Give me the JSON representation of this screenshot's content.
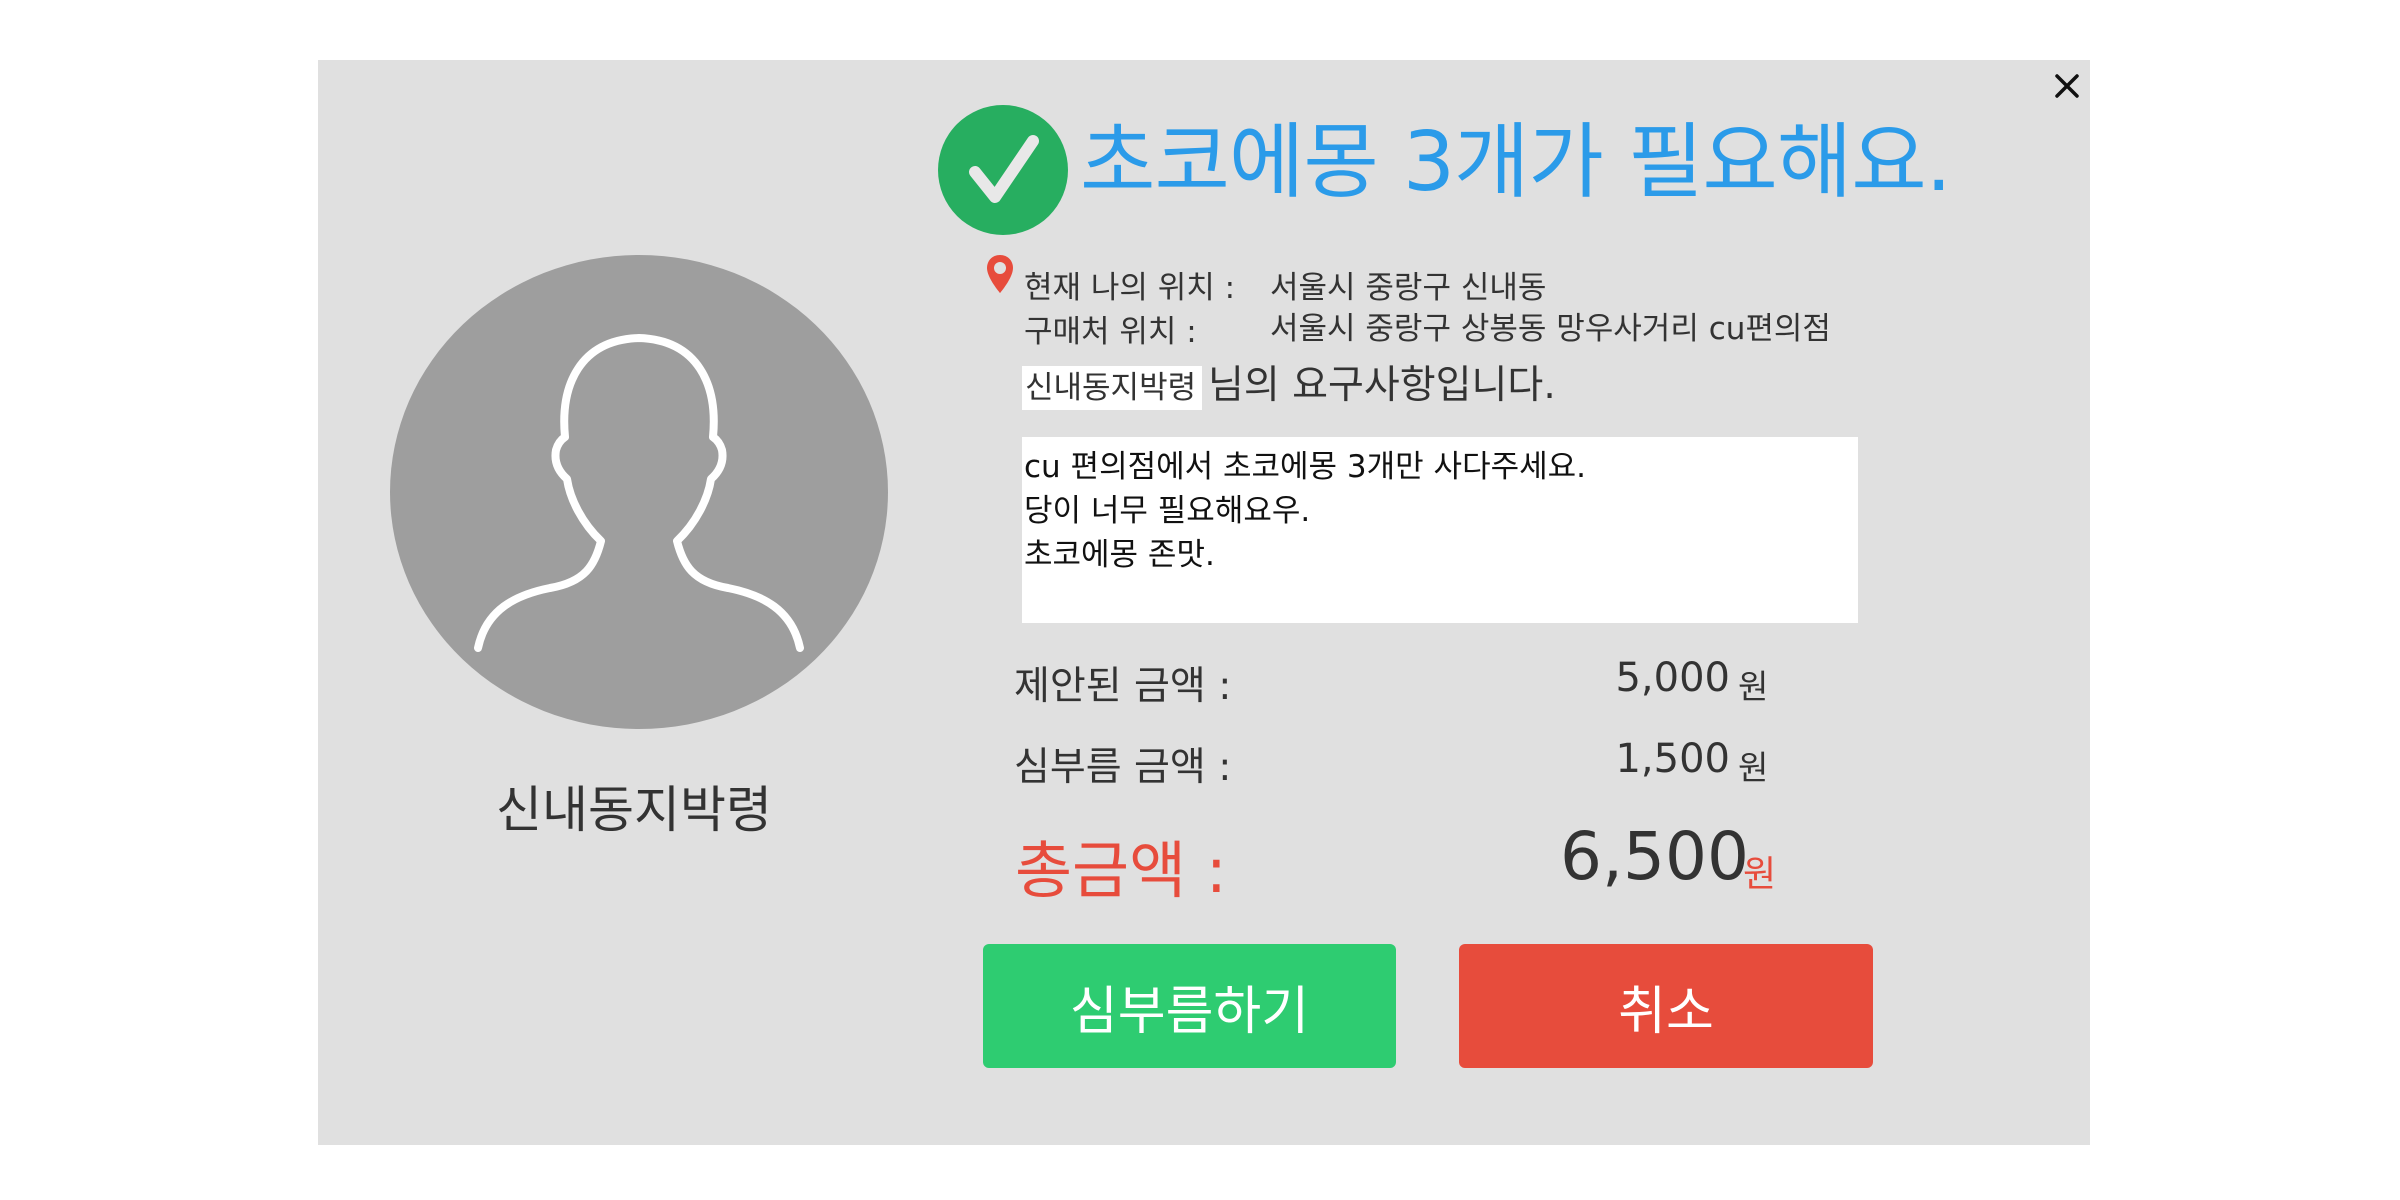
{
  "dialog": {
    "title": "초코에몽 3개가 필요해요.",
    "close_icon": "close-icon"
  },
  "user": {
    "name": "신내동지박령",
    "avatar_icon": "user-silhouette-icon"
  },
  "location": {
    "current_label": "현재 나의 위치 :",
    "current_value": "서울시 중랑구 신내동",
    "store_label": "구매처 위치 :",
    "store_value": "서울시 중랑구 상봉동 망우사거리 cu편의점",
    "pin_icon": "location-pin-icon"
  },
  "request": {
    "user_name": "신내동지박령",
    "suffix": "님의 요구사항입니다.",
    "lines": [
      "cu 편의점에서 초코에몽 3개만 사다주세요.",
      "당이 너무 필요해요우.",
      "초코에몽 존맛."
    ]
  },
  "pricing": {
    "proposed_label": "제안된 금액 :",
    "proposed_value": "5,000",
    "fee_label": "심부름 금액 :",
    "fee_value": "1,500",
    "currency": "원",
    "total_label": "총금액 :",
    "total_value": "6,500"
  },
  "actions": {
    "accept_label": "심부름하기",
    "cancel_label": "취소"
  },
  "colors": {
    "title": "#2b9be9",
    "check": "#27ae60",
    "accept": "#2ecc71",
    "cancel": "#e74c3c",
    "total": "#e74c3c"
  }
}
